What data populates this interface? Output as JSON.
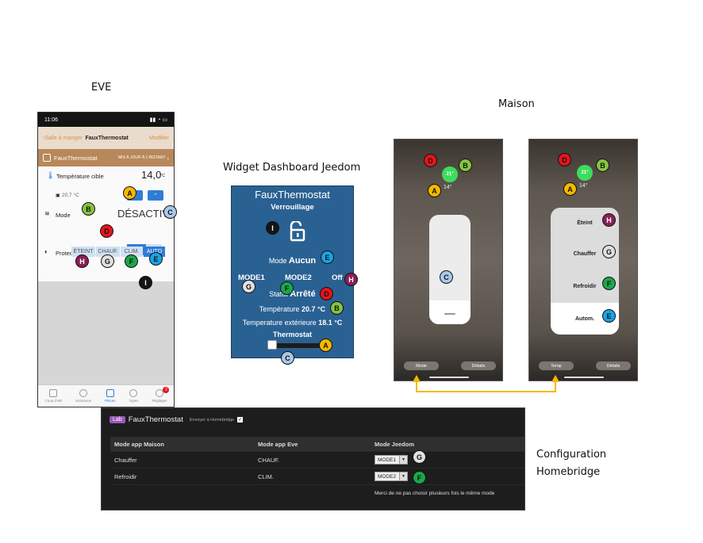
{
  "titles": {
    "eve": "EVE",
    "widget": "Widget Dashboard Jeedom",
    "maison": "Maison",
    "config_line1": "Configuration",
    "config_line2": "Homebridge"
  },
  "markers": {
    "A": "A",
    "B": "B",
    "C": "C",
    "D": "D",
    "E": "E",
    "F": "F",
    "G": "G",
    "H": "H",
    "I": "I"
  },
  "eve": {
    "time": "11:06",
    "back_label": "Salle à manger",
    "nav_title": "FauxThermostat",
    "edit_label": "Modifier",
    "device_name": "FauxThermostat",
    "device_status": "MIS À JOUR À L'INSTANT",
    "target_label": "Température cible",
    "target_value": "14,0",
    "target_unit": "°C",
    "current_temp": "20,7 °C",
    "mode_label": "Mode",
    "mode_value": "DÉSACTIVÉ",
    "modes": [
      "ÉTEINT",
      "CHAUF.",
      "CLIM.",
      "AUTO"
    ],
    "child_label": "Protection enfants",
    "toggle_on": "O",
    "toggle_off": "I",
    "tabs": [
      "Coup d'œil",
      "Scénarios",
      "Pièces",
      "Types",
      "Réglages"
    ],
    "badge": "2"
  },
  "widget": {
    "title": "FauxThermostat",
    "lock_label": "Verrouillage",
    "mode_prefix": "Mode",
    "mode_value": "Aucun",
    "modes": [
      "MODE1",
      "MODE2",
      "Off"
    ],
    "status_prefix": "Statut",
    "status_value": "Arrêté",
    "temp_prefix": "Température",
    "temp_value": "20.7 °C",
    "ext_prefix": "Temperature extérieure",
    "ext_value": "18.1 °C",
    "slider_label": "Thermostat"
  },
  "maison": {
    "left": {
      "target": "21°",
      "current": "14°",
      "btn_left": "Mode",
      "btn_right": "Détails"
    },
    "right": {
      "target": "21°",
      "current": "14°",
      "options": [
        "Éteint",
        "Chauffer",
        "Refroidir",
        "Autom."
      ],
      "btn_left": "Temp",
      "btn_right": "Détails"
    }
  },
  "homebridge": {
    "badge": "Lab",
    "title": "FauxThermostat",
    "send_label": "Envoyer à Homebridge",
    "headers": [
      "Mode app Maison",
      "Mode app Eve",
      "Mode Jeedom"
    ],
    "rows": [
      {
        "maison": "Chauffer",
        "eve": "CHAUF.",
        "jeedom": "MODE1"
      },
      {
        "maison": "Refroidir",
        "eve": "CLIM.",
        "jeedom": "MODE2"
      }
    ],
    "note": "Merci de ne pas choisir plusieurs fois le même mode"
  },
  "colors": {
    "widget_bg": "#2a6193",
    "eve_accent": "#2f7cd6",
    "maison_pill": "#3ddc5c",
    "arrow": "#f5b800"
  }
}
